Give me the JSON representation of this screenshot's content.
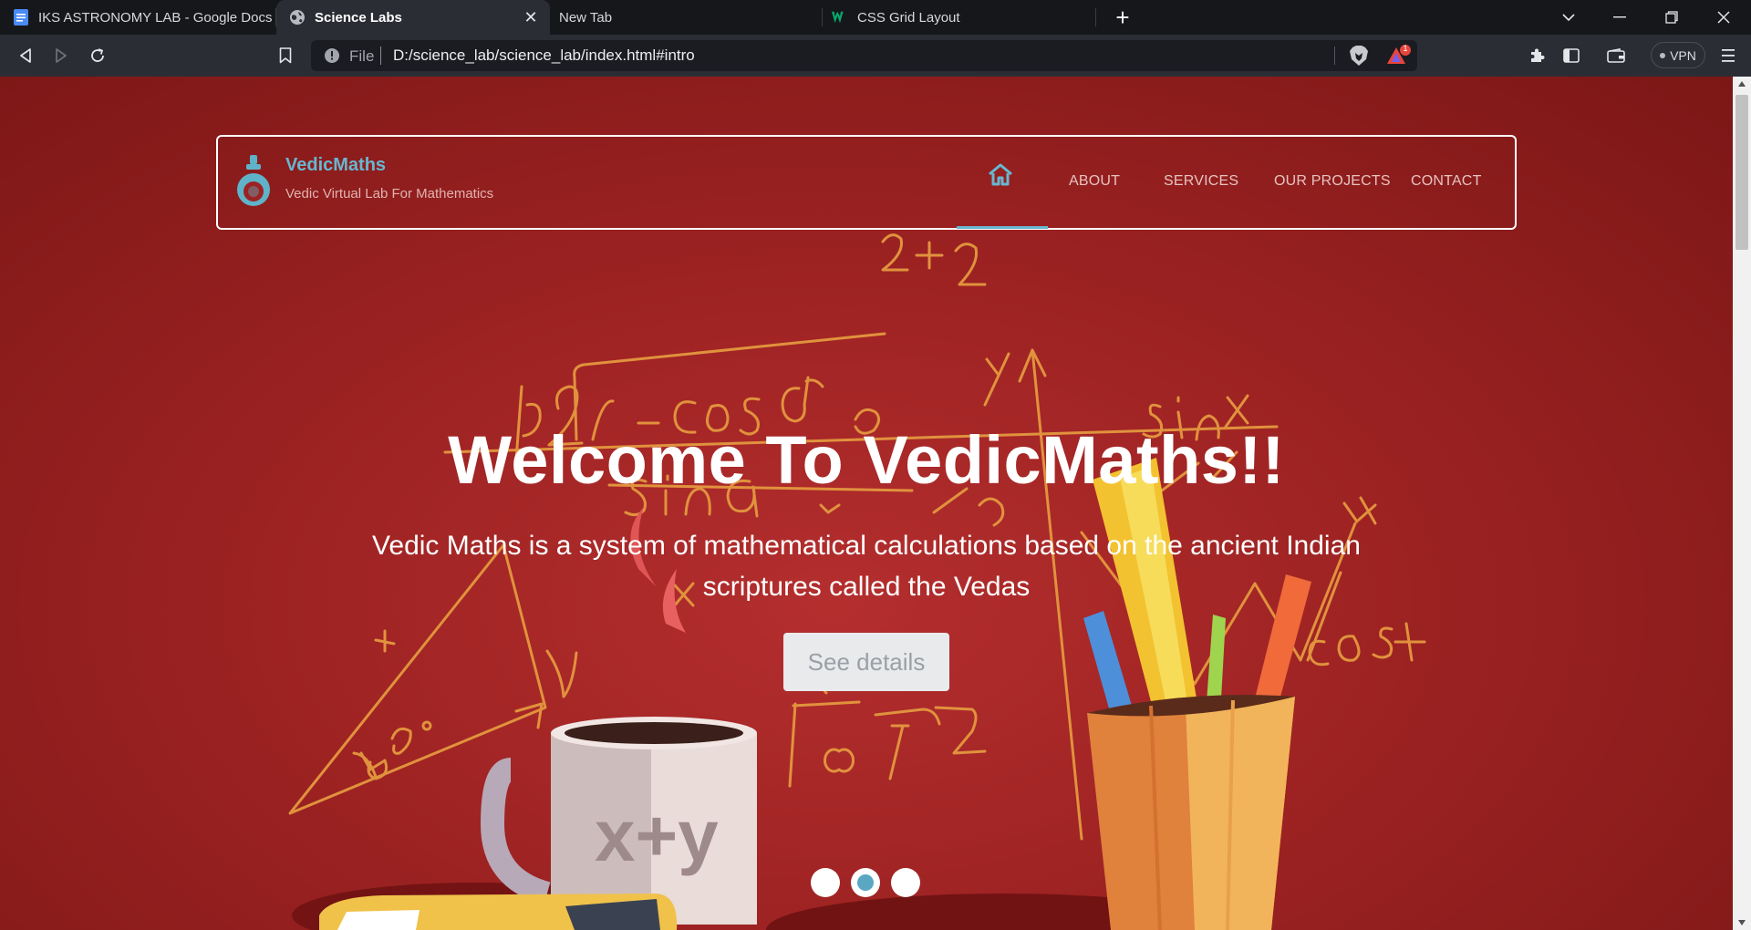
{
  "browser": {
    "tabs": [
      {
        "title": "IKS ASTRONOMY LAB - Google Docs",
        "icon": "google-docs-icon",
        "active": false
      },
      {
        "title": "Science Labs",
        "icon": "globe-icon",
        "active": true
      },
      {
        "title": "New Tab",
        "icon": "",
        "active": false
      },
      {
        "title": "CSS Grid Layout",
        "icon": "w3schools-icon",
        "active": false
      }
    ],
    "new_tab": "+",
    "address": {
      "scheme_label": "File",
      "url": "D:/science_lab/science_lab/index.html#intro"
    },
    "vpn_label": "VPN",
    "rewards_badge": "1"
  },
  "site": {
    "brand": {
      "name": "VedicMaths",
      "tagline": "Vedic Virtual Lab For Mathematics"
    },
    "nav": [
      {
        "label": "ABOUT"
      },
      {
        "label": "SERVICES"
      },
      {
        "label": "OUR PROJECTS"
      },
      {
        "label": "CONTACT"
      }
    ],
    "hero": {
      "title": "Welcome To VedicMaths!!",
      "subtitle_line1": "Vedic Maths is a system of mathematical calculations based on the ancient Indian",
      "subtitle_line2": "scriptures called the Vedas",
      "button": "See details",
      "slides": 3,
      "active_slide": 2
    },
    "illustration": {
      "sketch_labels": [
        "2+2",
        "sin x",
        "cos x",
        "45°",
        "x",
        "y",
        "x+y"
      ]
    }
  },
  "colors": {
    "accent": "#67b7d1",
    "hero_bg": "#a32626",
    "sketch": "#e0923d"
  }
}
